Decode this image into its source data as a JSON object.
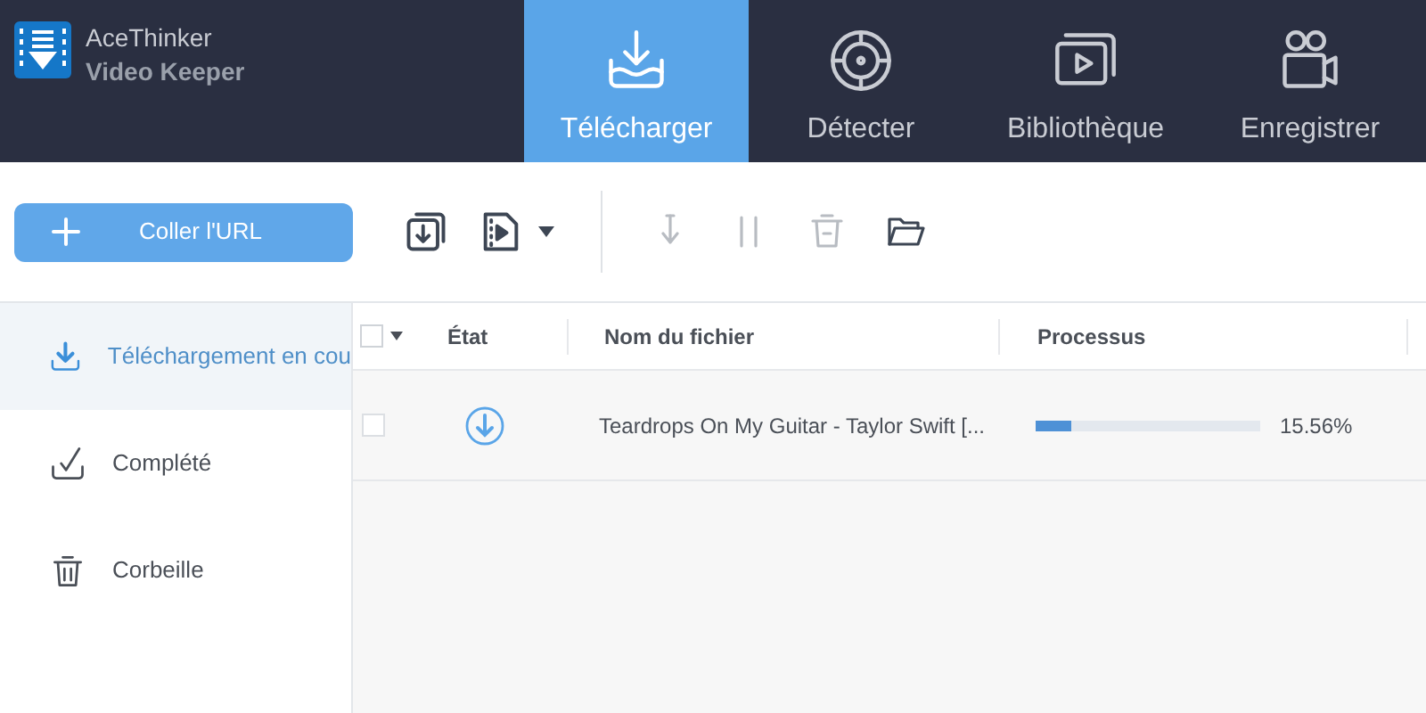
{
  "app": {
    "brand": "AceThinker",
    "product": "Video Keeper"
  },
  "tabs": [
    {
      "label": "Télécharger",
      "kind": "download",
      "selected": true
    },
    {
      "label": "Détecter",
      "kind": "target",
      "selected": false
    },
    {
      "label": "Bibliothèque",
      "kind": "library",
      "selected": false
    },
    {
      "label": "Enregistrer",
      "kind": "camera",
      "selected": false
    }
  ],
  "toolbar": {
    "paste_button": "Coller l'URL",
    "actions": [
      {
        "kind": "resume",
        "disabled": true
      },
      {
        "kind": "pause",
        "disabled": true
      },
      {
        "kind": "delete",
        "disabled": true
      },
      {
        "kind": "folder",
        "disabled": false
      }
    ]
  },
  "sidebar": {
    "items": [
      {
        "label": "Téléchargement en cou",
        "kind": "download",
        "selected": true
      },
      {
        "label": "Complété",
        "kind": "check",
        "selected": false
      },
      {
        "label": "Corbeille",
        "kind": "trash",
        "selected": false
      }
    ]
  },
  "table": {
    "select_all_checked": false,
    "columns": [
      "État",
      "Nom du fichier",
      "Processus"
    ],
    "rows": [
      {
        "checked": false,
        "file": "Teardrops On My Guitar - Taylor Swift [...",
        "level": 0.1556,
        "percent": "15.56%"
      }
    ]
  }
}
